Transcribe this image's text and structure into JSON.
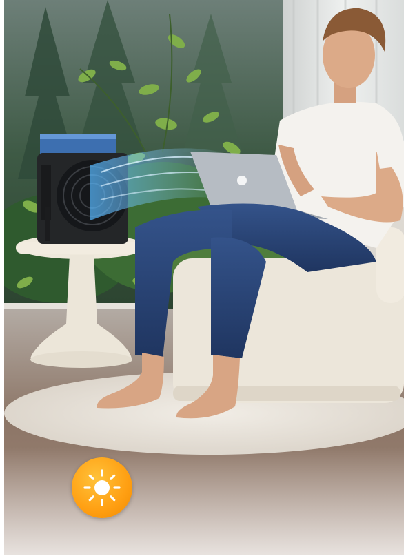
{
  "image": {
    "alt_subjects": [
      "man-with-laptop",
      "portable-air-cooler-fan",
      "side-table",
      "boucle-chair",
      "round-rug",
      "window-with-foliage"
    ],
    "product_label": "",
    "badge_icon": "sun-icon"
  },
  "colors": {
    "badge_orange": "#ff9f12",
    "badge_sun": "#ffffff",
    "jeans": "#2b4678",
    "tshirt": "#f4f2ee",
    "airflow_blue": "#4aa8ff",
    "floor": "#8a7060"
  }
}
